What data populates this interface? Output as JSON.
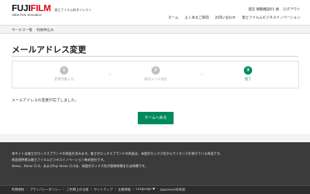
{
  "header": {
    "logo_prefix": "FUJI",
    "logo_accent": "FILM",
    "logo_tagline": "Value from Innovation",
    "brand_sub": "富士フイルムBIダイレクト",
    "user_name": "寝生 稼動確認01 様",
    "logout": "ログアウト",
    "nav": [
      "ホーム",
      "よくあるご質問",
      "お問い合わせ",
      "富士フイルムビジネスイノベーション"
    ]
  },
  "breadcrumb": [
    "サービス一覧",
    "利用申込み"
  ],
  "main": {
    "title": "メールアドレス変更",
    "steps": [
      {
        "num": "1",
        "label": "変更内容入力"
      },
      {
        "num": "2",
        "label": "案内メール送信"
      },
      {
        "num": "3",
        "label": "完了"
      }
    ],
    "separator": "›",
    "done_message": "メールアドレスの変更が完了しました。",
    "home_button": "ホームへ戻る"
  },
  "footer": {
    "lines": [
      "本サイトは富士ゼロックスブランドの商品を含みます。富士ゼロックスブランドの商品は、米国ゼロックス社からライセンスを受けている商品です。",
      "商品提供者は富士フイルムビジネスイノベーション株式会社です。",
      "Xerox、Xerox ロゴ、およびFuji Xerox ロゴは、米国ゼロックス社の登録商標または商標です。"
    ],
    "links": [
      "利用規約",
      "プライバシーポリシー",
      "ご利用上の注意",
      "サイトマップ",
      "企業情報",
      "Language ▼",
      "Japanese/日本語"
    ]
  },
  "colors": {
    "accent_green": "#008b5e",
    "logo_red": "#e60012",
    "footer_bg": "#3b3b3b"
  }
}
